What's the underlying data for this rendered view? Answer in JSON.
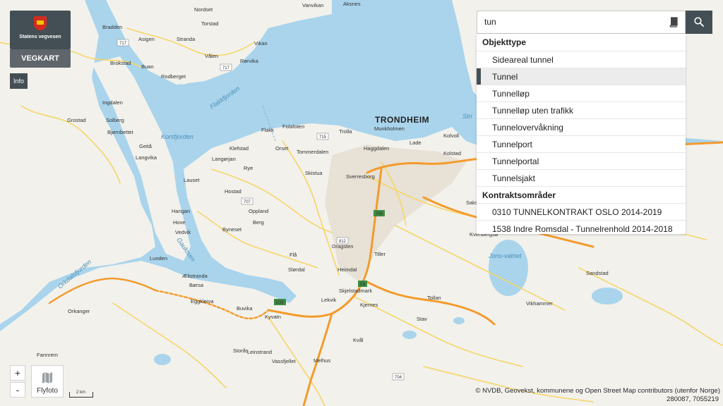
{
  "header": {
    "logo_text": "Statens vegvesen",
    "app_name": "VEGKART",
    "info_label": "Info"
  },
  "search": {
    "value": "tun",
    "icons": {
      "dictionary": "book-icon",
      "search": "magnifier-icon"
    }
  },
  "dropdown": {
    "groups": [
      {
        "title": "Objekttype",
        "items": [
          "Sideareal tunnel",
          "Tunnel",
          "Tunnelløp",
          "Tunnelløp uten trafikk",
          "Tunnelovervåkning",
          "Tunnelport",
          "Tunnelportal",
          "Tunnelsjakt"
        ]
      },
      {
        "title": "Kontraktsområder",
        "items": [
          "0310 TUNNELKONTRAKT OSLO 2014-2019",
          "1538 Indre Romsdal - Tunnelrenhold 2014-2018"
        ]
      }
    ],
    "selected": "Tunnel"
  },
  "map": {
    "city": "TRONDHEIM",
    "water_labels": [
      "Korsfjorden",
      "Flakkfjorden",
      "Gaulosen",
      "Orkdalsfjorden",
      "Jons-vatnet",
      "Stri"
    ],
    "places": [
      "Vanvikan",
      "Aksnes",
      "Nordset",
      "Bradden",
      "Torstad",
      "Vikan",
      "Asigen",
      "Stranda",
      "Vålen",
      "Brokstad",
      "Buan",
      "Rodberget",
      "Rørvika",
      "Ingdalen",
      "Solberg",
      "Grostad",
      "Bjørnbettet",
      "Geitå",
      "Langvika",
      "Flakk",
      "Folafoten",
      "Trolla",
      "Munkholmen",
      "Klefstad",
      "Orset",
      "Tommerdalen",
      "Haggdalen",
      "Lade",
      "Rye",
      "Kolstad",
      "Kolvoll",
      "Langørjan",
      "Skistua",
      "Sverresborg",
      "Lauset",
      "Hostad",
      "Oppland",
      "Hangan",
      "Hove",
      "Vedvik",
      "Byneset",
      "Berg",
      "Heimdal",
      "Tiller",
      "Lunden",
      "Ælistranda",
      "Børsa",
      "Buvika",
      "Orkanger",
      "Fannrem",
      "Melhus",
      "Kvål",
      "Lekvik",
      "Vassfjellet",
      "Saksvik",
      "Skjelstadmark",
      "Tollan",
      "Stav",
      "Dragsten",
      "Slørdal",
      "Kjernes",
      "Storås",
      "Flå",
      "Eggkleiva",
      "Leinstrand",
      "Kyvatn",
      "Heggstad",
      "Kvenbergsø",
      "Vikhammer",
      "Sandstad",
      "Dalen",
      "Aune"
    ],
    "road_shields": [
      "717",
      "717",
      "715",
      "707",
      "706",
      "812",
      "E6",
      "E39",
      "704"
    ]
  },
  "controls": {
    "zoom_in": "+",
    "zoom_out": "-",
    "flyfoto": "Flyfoto",
    "scale": "2 km"
  },
  "footer": {
    "attribution": "© NVDB, Geovekst, kommunene og Open Street Map contributors (utenfor Norge)",
    "coords": "280087, 7055219"
  },
  "colors": {
    "water": "#a9d4ec",
    "land": "#f2f1ec",
    "panel_dark": "#444f55",
    "major_road": "#f39b2b",
    "secondary_road": "#f6d667",
    "crest_red": "#d32b1e"
  }
}
